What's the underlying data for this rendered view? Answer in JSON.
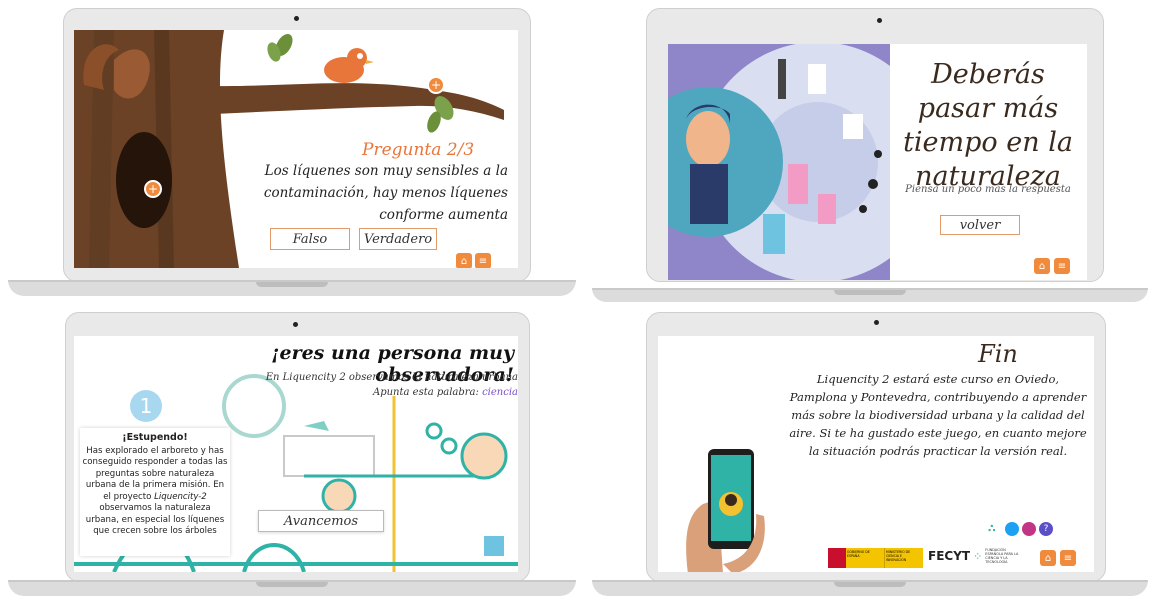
{
  "panel1": {
    "question_title": "Pregunta 2/3",
    "question_text": "Los líquenes son muy sensibles a la contaminación, hay menos líquenes conforme aumenta",
    "btn_false": "Falso",
    "btn_true": "Verdadero",
    "plus_symbol": "+",
    "home_icon": "home-icon",
    "menu_icon": "menu-icon"
  },
  "panel2": {
    "heading": "Deberás pasar más tiempo en la naturaleza",
    "hint": "Piensa un poco más la respuesta",
    "back_button": "volver",
    "home_icon": "home-icon",
    "menu_icon": "menu-icon"
  },
  "panel3": {
    "heading": "¡eres una persona muy observadora!",
    "subtitle_line1": "En Liquencity 2 observamos la naturaleza urbana",
    "subtitle_line2_prefix": "Apunta esta palabra: ",
    "subtitle_keyword": "ciencia",
    "step_number": "1",
    "card_title": "¡Estupendo!",
    "card_text_1": "Has explorado el arboreto y has conseguido responder a todas las preguntas sobre naturaleza urbana de la primera misión. En el proyecto ",
    "card_text_italic": "Liquencity-2",
    "card_text_2": " observamos la naturaleza urbana, en especial los líquenes que crecen sobre los árboles",
    "continue_button": "Avancemos"
  },
  "panel4": {
    "heading": "Fin",
    "body": "Liquencity 2 estará este curso en Oviedo, Pamplona y Pontevedra, contribuyendo a aprender más sobre la biodiversidad urbana y la calidad del aire. Si te ha gustado este juego, en cuanto mejore la situación podrás practicar la versión real.",
    "fecyt_label": "FECYT",
    "fecyt_sub": "FUNDACIÓN ESPAÑOLA PARA LA CIENCIA Y LA TECNOLOGÍA",
    "gov_label1": "GOBIERNO DE ESPAÑA",
    "gov_label2": "MINISTERIO DE CIENCIA E INNOVACIÓN",
    "help_symbol": "?",
    "home_icon": "home-icon",
    "menu_icon": "menu-icon"
  },
  "colors": {
    "accent_orange": "#f08a3c",
    "tree_brown": "#5a3a22",
    "lilac": "#8f86c9",
    "teal": "#2fb3a6"
  }
}
